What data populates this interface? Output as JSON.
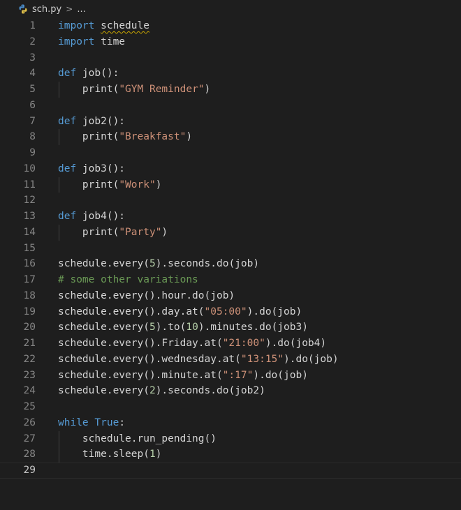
{
  "breadcrumb": {
    "file": "sch.py",
    "separator": ">",
    "more": "...",
    "icon": "python-icon"
  },
  "editor": {
    "current_line": 29,
    "lines": [
      {
        "n": "1",
        "text": "import schedule",
        "indent": false
      },
      {
        "n": "2",
        "text": "import time",
        "indent": false
      },
      {
        "n": "3",
        "text": "",
        "indent": false
      },
      {
        "n": "4",
        "text": "def job():",
        "indent": false
      },
      {
        "n": "5",
        "text": "    print(\"GYM Reminder\")",
        "indent": true
      },
      {
        "n": "6",
        "text": "",
        "indent": false
      },
      {
        "n": "7",
        "text": "def job2():",
        "indent": false
      },
      {
        "n": "8",
        "text": "    print(\"Breakfast\")",
        "indent": true
      },
      {
        "n": "9",
        "text": "",
        "indent": false
      },
      {
        "n": "10",
        "text": "def job3():",
        "indent": false
      },
      {
        "n": "11",
        "text": "    print(\"Work\")",
        "indent": true
      },
      {
        "n": "12",
        "text": "",
        "indent": false
      },
      {
        "n": "13",
        "text": "def job4():",
        "indent": false
      },
      {
        "n": "14",
        "text": "    print(\"Party\")",
        "indent": true
      },
      {
        "n": "15",
        "text": "",
        "indent": false
      },
      {
        "n": "16",
        "text": "schedule.every(5).seconds.do(job)",
        "indent": false
      },
      {
        "n": "17",
        "text": "# some other variations",
        "indent": false
      },
      {
        "n": "18",
        "text": "schedule.every().hour.do(job)",
        "indent": false
      },
      {
        "n": "19",
        "text": "schedule.every().day.at(\"05:00\").do(job)",
        "indent": false
      },
      {
        "n": "20",
        "text": "schedule.every(5).to(10).minutes.do(job3)",
        "indent": false
      },
      {
        "n": "21",
        "text": "schedule.every().Friday.at(\"21:00\").do(job4)",
        "indent": false
      },
      {
        "n": "22",
        "text": "schedule.every().wednesday.at(\"13:15\").do(job)",
        "indent": false
      },
      {
        "n": "23",
        "text": "schedule.every().minute.at(\":17\").do(job)",
        "indent": false
      },
      {
        "n": "24",
        "text": "schedule.every(2).seconds.do(job2)",
        "indent": false
      },
      {
        "n": "25",
        "text": "",
        "indent": false
      },
      {
        "n": "26",
        "text": "while True:",
        "indent": false
      },
      {
        "n": "27",
        "text": "    schedule.run_pending()",
        "indent": true
      },
      {
        "n": "28",
        "text": "    time.sleep(1)",
        "indent": true
      },
      {
        "n": "29",
        "text": "",
        "indent": false
      }
    ]
  },
  "colors": {
    "background": "#1e1e1e",
    "keyword": "#569cd6",
    "string": "#ce9178",
    "number": "#b5cea8",
    "comment": "#6a9955",
    "text": "#d4d4d4",
    "line_number": "#858585",
    "squiggle": "#cca700"
  }
}
